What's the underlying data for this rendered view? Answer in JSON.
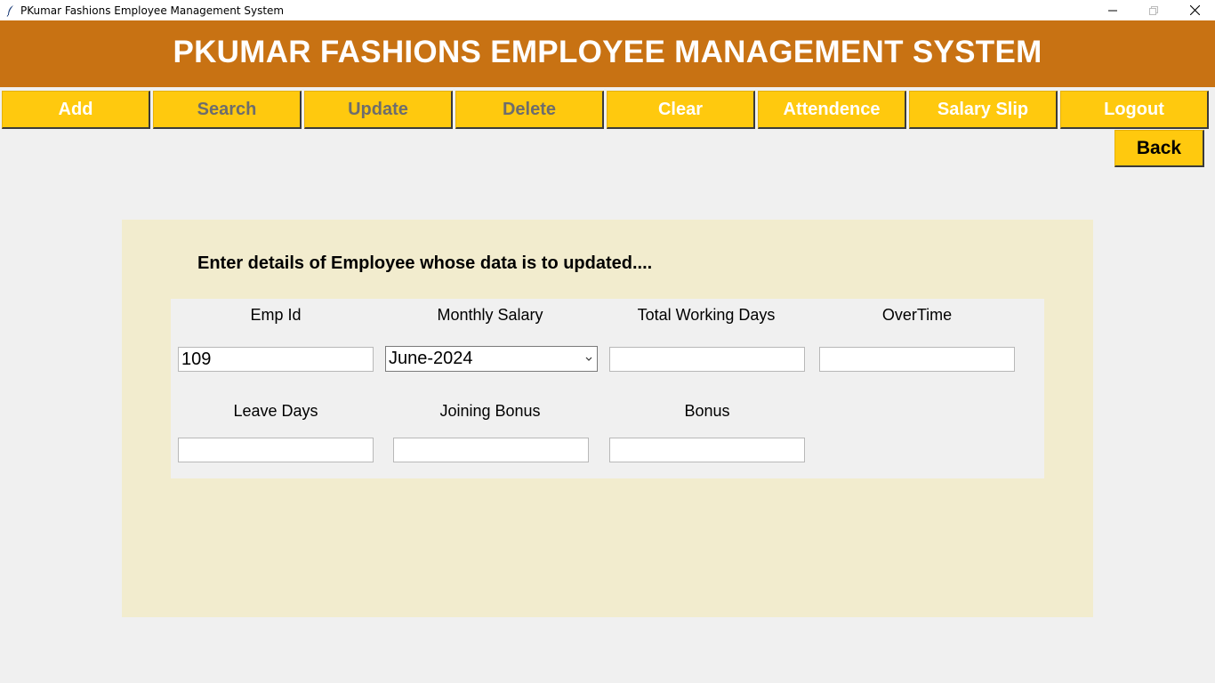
{
  "window": {
    "title": "PKumar Fashions Employee Management System"
  },
  "header": {
    "title": "PKUMAR FASHIONS EMPLOYEE MANAGEMENT SYSTEM"
  },
  "toolbar": {
    "add": "Add",
    "search": "Search",
    "update": "Update",
    "delete": "Delete",
    "clear": "Clear",
    "attendence": "Attendence",
    "salary_slip": "Salary Slip",
    "logout": "Logout"
  },
  "back_label": "Back",
  "form": {
    "heading": "Enter details of Employee whose data is to updated....",
    "emp_id": {
      "label": "Emp Id",
      "value": "109"
    },
    "monthly_salary": {
      "label": "Monthly Salary",
      "value": "June-2024"
    },
    "total_working_days": {
      "label": "Total Working Days",
      "value": ""
    },
    "overtime": {
      "label": "OverTime",
      "value": ""
    },
    "leave_days": {
      "label": "Leave Days",
      "value": ""
    },
    "joining_bonus": {
      "label": "Joining Bonus",
      "value": ""
    },
    "bonus": {
      "label": "Bonus",
      "value": ""
    }
  },
  "colors": {
    "header_bg": "#c87213",
    "button_bg": "#ffc90e",
    "panel_bg": "#f2ecce"
  },
  "icons": {
    "app": "feather-icon",
    "minimize": "minimize-icon",
    "maximize": "maximize-icon",
    "close": "close-icon",
    "dropdown": "chevron-down-icon"
  }
}
